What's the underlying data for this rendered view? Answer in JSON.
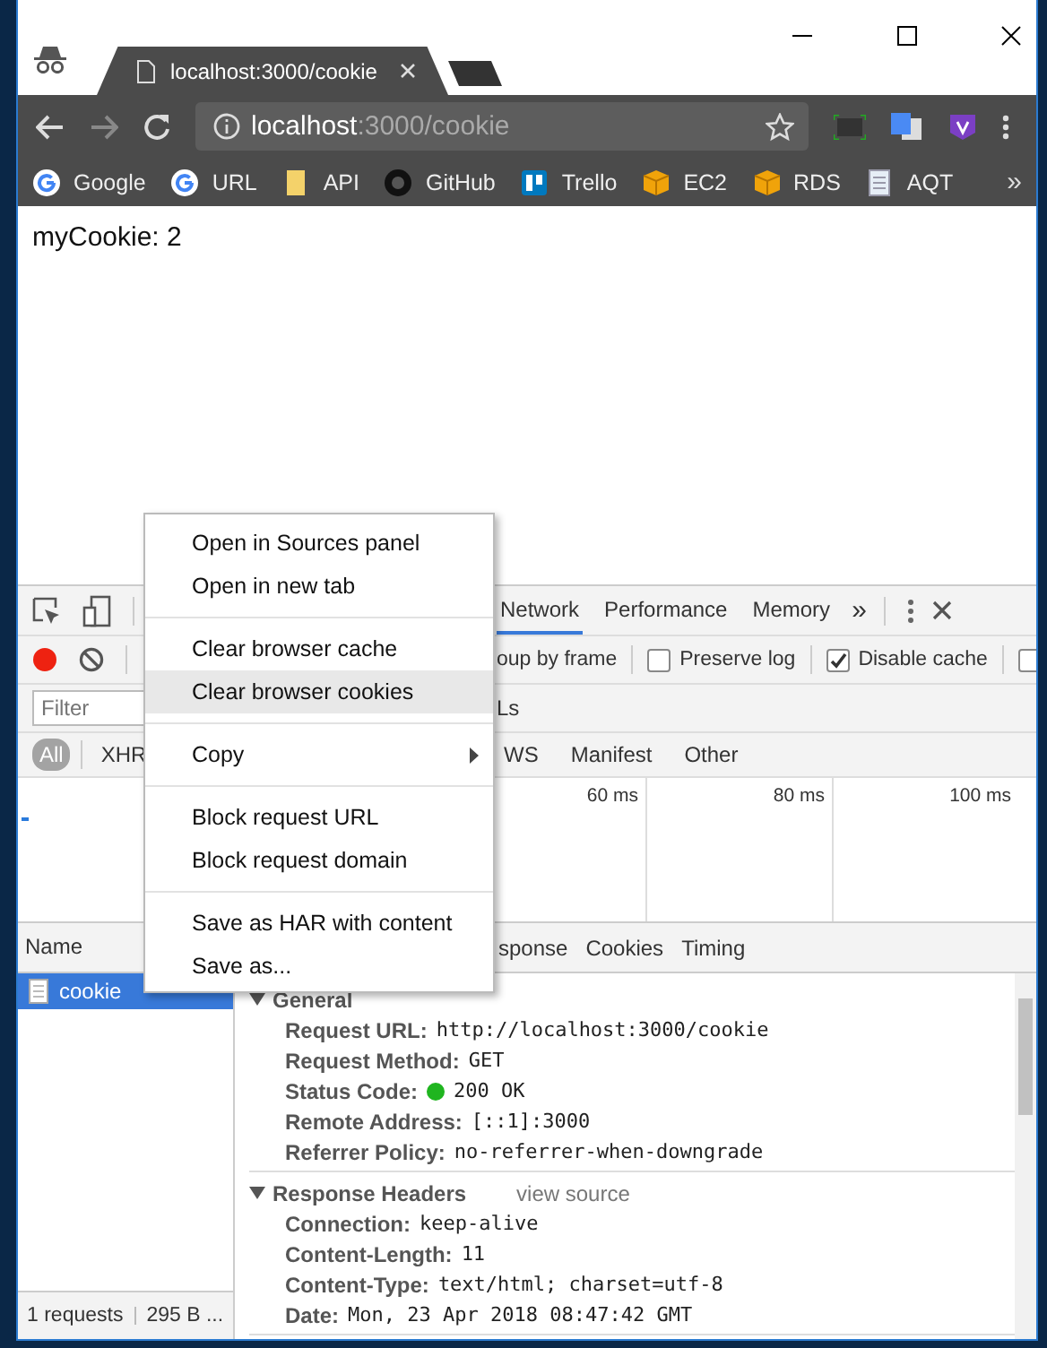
{
  "browser_tab": {
    "title": "localhost:3000/cookie"
  },
  "address_bar": {
    "host": "localhost",
    "path": ":3000/cookie"
  },
  "bookmarks": [
    {
      "label": "Google",
      "kind": "google"
    },
    {
      "label": "URL",
      "kind": "google"
    },
    {
      "label": "API",
      "kind": "folder"
    },
    {
      "label": "GitHub",
      "kind": "github"
    },
    {
      "label": "Trello",
      "kind": "trello"
    },
    {
      "label": "EC2",
      "kind": "box"
    },
    {
      "label": "RDS",
      "kind": "box"
    },
    {
      "label": "AQT",
      "kind": "doc"
    }
  ],
  "bookmarks_more": "»",
  "page": {
    "text": "myCookie: 2"
  },
  "devtools": {
    "panel_tabs": [
      {
        "label": "Network",
        "selected": true
      },
      {
        "label": "Performance",
        "selected": false
      },
      {
        "label": "Memory",
        "selected": false
      }
    ],
    "panel_more": "»",
    "toolbar": {
      "recording": true,
      "cut_label": "oup by frame",
      "options": [
        {
          "label": "Preserve log",
          "checked": false
        },
        {
          "label": "Disable cache",
          "checked": true
        }
      ],
      "edge_checkbox": {
        "checked": false
      }
    },
    "filter": {
      "placeholder": "Filter",
      "cut_label": "Ls"
    },
    "type_filters": [
      {
        "label": "All",
        "selected": true
      },
      {
        "label": "XHR",
        "selected": false
      },
      {
        "label": "WS",
        "selected": false
      },
      {
        "label": "Manifest",
        "selected": false
      },
      {
        "label": "Other",
        "selected": false
      }
    ],
    "timeline_ticks": [
      "60 ms",
      "80 ms",
      "100 ms"
    ],
    "requests": {
      "column": "Name",
      "rows": [
        {
          "name": "cookie",
          "selected": true
        }
      ],
      "summary": "1 requests",
      "size": "295 B ..."
    },
    "detail_tabs": [
      "sponse",
      "Cookies",
      "Timing"
    ],
    "sections": [
      {
        "title": "General",
        "expanded": true,
        "rows": [
          {
            "key": "Request URL:",
            "value": "http://localhost:3000/cookie"
          },
          {
            "key": "Request Method:",
            "value": "GET"
          },
          {
            "key": "Status Code:",
            "value": "200 OK",
            "color": "#1fb51f"
          },
          {
            "key": "Remote Address:",
            "value": "[::1]:3000"
          },
          {
            "key": "Referrer Policy:",
            "value": "no-referrer-when-downgrade"
          }
        ]
      },
      {
        "title": "Response Headers",
        "expanded": true,
        "link": "view source",
        "rows": [
          {
            "key": "Connection:",
            "value": "keep-alive"
          },
          {
            "key": "Content-Length:",
            "value": "11"
          },
          {
            "key": "Content-Type:",
            "value": "text/html; charset=utf-8"
          },
          {
            "key": "Date:",
            "value": "Mon, 23 Apr 2018 08:47:42 GMT"
          }
        ]
      }
    ]
  },
  "context_menu": {
    "groups": [
      [
        {
          "label": "Open in Sources panel",
          "highlighted": false,
          "submenu": false
        },
        {
          "label": "Open in new tab",
          "highlighted": false,
          "submenu": false
        }
      ],
      [
        {
          "label": "Clear browser cache",
          "highlighted": false,
          "submenu": false
        },
        {
          "label": "Clear browser cookies",
          "highlighted": true,
          "submenu": false
        }
      ],
      [
        {
          "label": "Copy",
          "highlighted": false,
          "submenu": true
        }
      ],
      [
        {
          "label": "Block request URL",
          "highlighted": false,
          "submenu": false
        },
        {
          "label": "Block request domain",
          "highlighted": false,
          "submenu": false
        }
      ],
      [
        {
          "label": "Save as HAR with content",
          "highlighted": false,
          "submenu": false
        },
        {
          "label": "Save as...",
          "highlighted": false,
          "submenu": false
        }
      ]
    ]
  }
}
